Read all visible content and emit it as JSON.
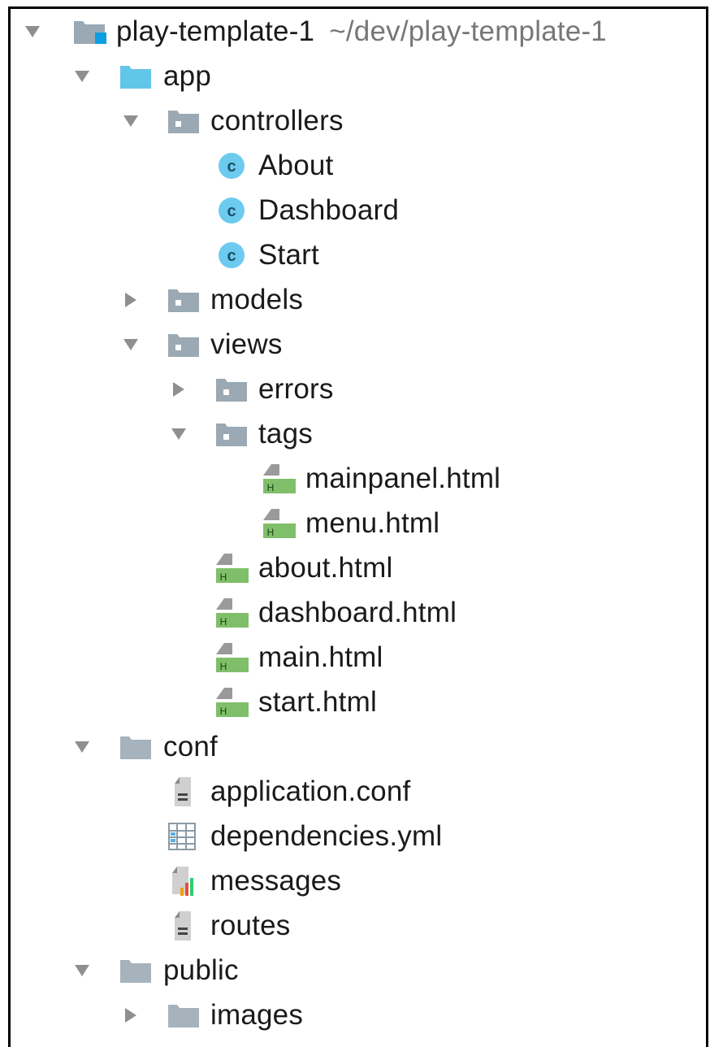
{
  "tree": {
    "root": {
      "label": "play-template-1",
      "path": "~/dev/play-template-1"
    },
    "app": {
      "label": "app",
      "controllers": {
        "label": "controllers",
        "classes": [
          "About",
          "Dashboard",
          "Start"
        ],
        "class_badge": "c"
      },
      "models": {
        "label": "models"
      },
      "views": {
        "label": "views",
        "errors": {
          "label": "errors"
        },
        "tags": {
          "label": "tags",
          "files": [
            "mainpanel.html",
            "menu.html"
          ]
        },
        "files": [
          "about.html",
          "dashboard.html",
          "main.html",
          "start.html"
        ]
      }
    },
    "conf": {
      "label": "conf",
      "files": [
        "application.conf",
        "dependencies.yml",
        "messages",
        "routes"
      ]
    },
    "public": {
      "label": "public",
      "images": {
        "label": "images"
      }
    },
    "html_badge": "H"
  },
  "colors": {
    "app_folder": "#62c6e8",
    "package_folder": "#9aa9b3",
    "plain_folder": "#a6b3bc",
    "class_circle": "#6ccbee",
    "html_badge": "#7fbf6a",
    "module_accent": "#0b9ee0"
  },
  "icons": {
    "expanded": "triangle-down-icon",
    "collapsed": "triangle-right-icon",
    "module": "module-folder-icon",
    "source_folder": "source-folder-icon",
    "package": "package-folder-icon",
    "folder": "folder-icon",
    "class": "class-icon",
    "html": "html-file-icon",
    "text": "text-file-icon",
    "yml": "yml-file-icon",
    "properties": "properties-file-icon"
  }
}
